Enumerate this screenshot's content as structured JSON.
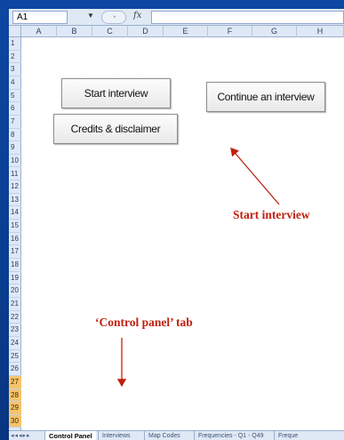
{
  "formula_bar": {
    "cell_ref": "A1",
    "fx_label": "fx",
    "formula": ""
  },
  "columns": [
    "A",
    "B",
    "C",
    "D",
    "E",
    "F",
    "G",
    "H"
  ],
  "rows": [
    "1",
    "2",
    "3",
    "4",
    "5",
    "6",
    "7",
    "8",
    "9",
    "10",
    "11",
    "12",
    "13",
    "14",
    "15",
    "16",
    "17",
    "18",
    "19",
    "20",
    "21",
    "22",
    "23",
    "24",
    "25",
    "26",
    "27",
    "28",
    "29",
    "30"
  ],
  "selected_rows": [
    "27",
    "28",
    "29",
    "30"
  ],
  "buttons": {
    "start_interview": "Start interview",
    "continue_interview": "Continue an interview",
    "credits": "Credits & disclaimer"
  },
  "annotations": {
    "start_interview": "Start interview",
    "control_panel_tab": "‘Control panel’ tab"
  },
  "tabs": [
    "Control Panel",
    "Interviews",
    "Map Codes",
    "Frequencies - Q1 - Q49",
    "Freque"
  ],
  "active_tab": "Control Panel",
  "colors": {
    "annotation": "#c0200f",
    "frame": "#0d47a1",
    "header": "#dfe8f5"
  }
}
